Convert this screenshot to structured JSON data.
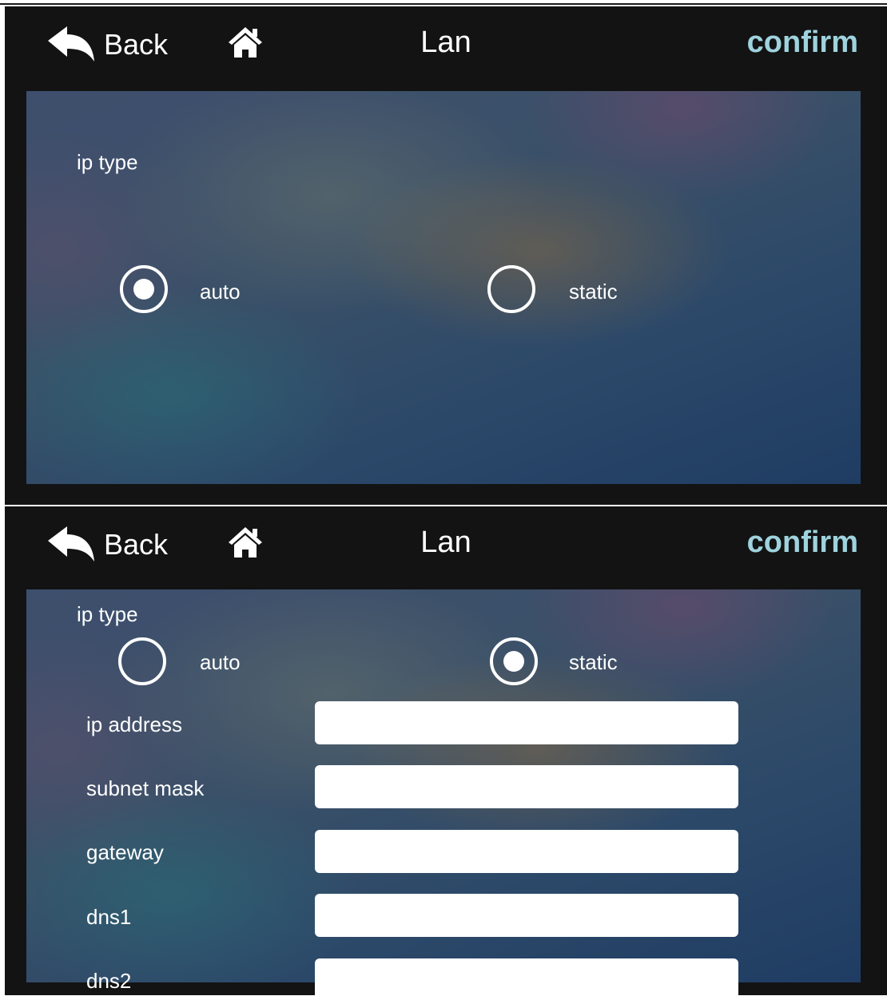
{
  "screens": [
    {
      "header": {
        "back_label": "Back",
        "title": "Lan",
        "confirm_label": "confirm"
      },
      "ip_type_label": "ip type",
      "radio_auto": {
        "label": "auto",
        "selected": true
      },
      "radio_static": {
        "label": "static",
        "selected": false
      }
    },
    {
      "header": {
        "back_label": "Back",
        "title": "Lan",
        "confirm_label": "confirm"
      },
      "ip_type_label": "ip type",
      "radio_auto": {
        "label": "auto",
        "selected": false
      },
      "radio_static": {
        "label": "static",
        "selected": true
      },
      "fields": [
        {
          "label": "ip address",
          "value": ""
        },
        {
          "label": "subnet mask",
          "value": ""
        },
        {
          "label": "gateway",
          "value": ""
        },
        {
          "label": "dns1",
          "value": ""
        },
        {
          "label": "dns2",
          "value": ""
        }
      ]
    }
  ],
  "icons": {
    "back": "back-arrow-icon",
    "home": "home-icon"
  },
  "colors": {
    "accent": "#9fd3de",
    "header_bg": "#131313",
    "text": "#ffffff"
  }
}
